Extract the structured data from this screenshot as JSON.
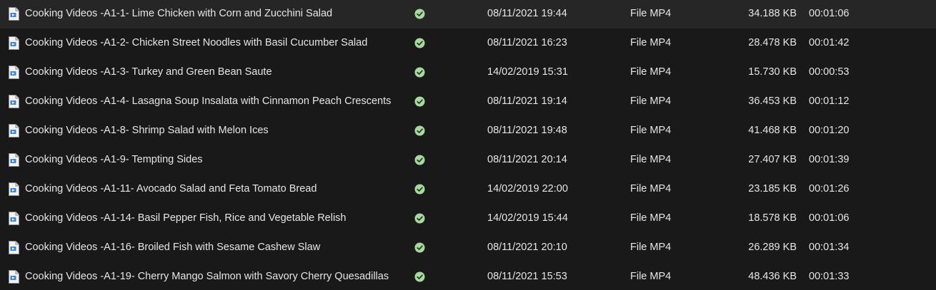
{
  "colors": {
    "background": "#191919",
    "text": "#e6e6e6",
    "sync_check_fill": "#a8d8a0",
    "sync_check_mark": "#1e3a1e",
    "file_icon_paper": "#f2f2f2",
    "file_icon_accent": "#3c86d6"
  },
  "icons": {
    "file": "video-file-icon",
    "status": "available-offline-check-icon"
  },
  "files": [
    {
      "name": "Cooking Videos -A1-1- Lime Chicken with Corn and Zucchini Salad",
      "date": "08/11/2021 19:44",
      "type": "File MP4",
      "size": "34.188 KB",
      "length": "00:01:06"
    },
    {
      "name": "Cooking Videos -A1-2- Chicken Street Noodles with Basil Cucumber Salad",
      "date": "08/11/2021 16:23",
      "type": "File MP4",
      "size": "28.478 KB",
      "length": "00:01:42"
    },
    {
      "name": "Cooking Videos -A1-3- Turkey and Green Bean Saute",
      "date": "14/02/2019 15:31",
      "type": "File MP4",
      "size": "15.730 KB",
      "length": "00:00:53"
    },
    {
      "name": "Cooking Videos -A1-4- Lasagna Soup Insalata with Cinnamon Peach Crescents",
      "date": "08/11/2021 19:14",
      "type": "File MP4",
      "size": "36.453 KB",
      "length": "00:01:12"
    },
    {
      "name": "Cooking Videos -A1-8- Shrimp Salad with Melon Ices",
      "date": "08/11/2021 19:48",
      "type": "File MP4",
      "size": "41.468 KB",
      "length": "00:01:20"
    },
    {
      "name": "Cooking Videos -A1-9- Tempting Sides",
      "date": "08/11/2021 20:14",
      "type": "File MP4",
      "size": "27.407 KB",
      "length": "00:01:39"
    },
    {
      "name": "Cooking Videos -A1-11- Avocado Salad and Feta Tomato Bread",
      "date": "14/02/2019 22:00",
      "type": "File MP4",
      "size": "23.185 KB",
      "length": "00:01:26"
    },
    {
      "name": "Cooking Videos -A1-14- Basil Pepper Fish, Rice and Vegetable Relish",
      "date": "14/02/2019 15:44",
      "type": "File MP4",
      "size": "18.578 KB",
      "length": "00:01:06"
    },
    {
      "name": "Cooking Videos -A1-16- Broiled Fish with Sesame Cashew Slaw",
      "date": "08/11/2021 20:10",
      "type": "File MP4",
      "size": "26.289 KB",
      "length": "00:01:34"
    },
    {
      "name": "Cooking Videos -A1-19- Cherry Mango Salmon with Savory Cherry Quesadillas",
      "date": "08/11/2021 15:53",
      "type": "File MP4",
      "size": "48.436 KB",
      "length": "00:01:33"
    }
  ]
}
